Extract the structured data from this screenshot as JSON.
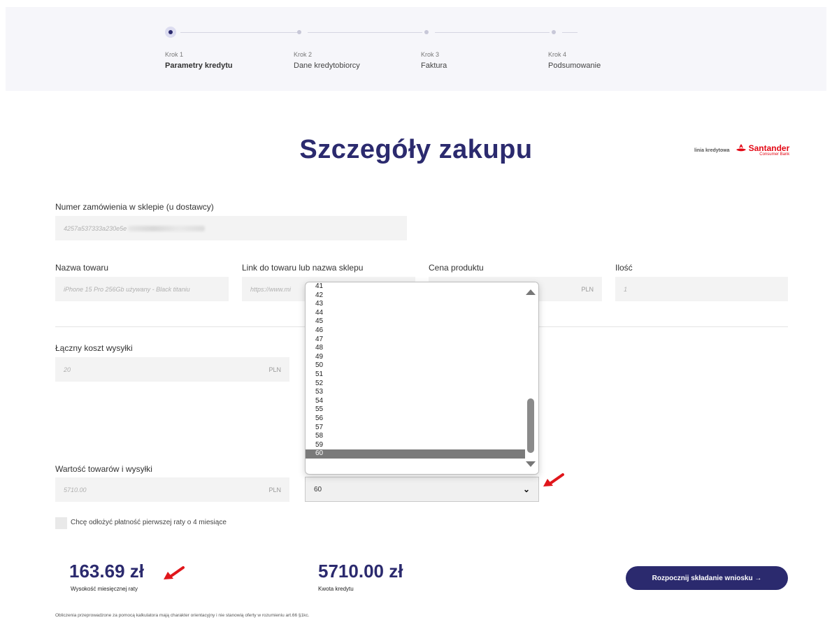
{
  "stepper": {
    "steps": [
      {
        "krok": "Krok 1",
        "name": "Parametry kredytu"
      },
      {
        "krok": "Krok 2",
        "name": "Dane kredytobiorcy"
      },
      {
        "krok": "Krok 3",
        "name": "Faktura"
      },
      {
        "krok": "Krok 4",
        "name": "Podsumowanie"
      }
    ]
  },
  "page": {
    "title": "Szczegóły zakupu"
  },
  "brand": {
    "linia": "linia kredytowa",
    "name": "Santander",
    "sub": "Consumer Bank",
    "color": "#e30613"
  },
  "form": {
    "order_label": "Numer zamówienia w sklepie (u dostawcy)",
    "order_value": "4257a537333a230e5e",
    "product_label": "Nazwa towaru",
    "product_value": "iPhone 15 Pro  256Gb używany - Black titaniu",
    "link_label": "Link do towaru lub nazwa sklepu",
    "link_value": "https://www.mi",
    "price_label": "Cena produktu",
    "price_unit": "PLN",
    "qty_label": "Ilość",
    "qty_value": "1",
    "shipping_label": "Łączny koszt wysyłki",
    "shipping_value": "20",
    "shipping_unit": "PLN",
    "total_label": "Wartość towarów i wysyłki",
    "total_value": "5710.00",
    "total_unit": "PLN",
    "installments_selected": "60",
    "installments_options": [
      "41",
      "42",
      "43",
      "44",
      "45",
      "46",
      "47",
      "48",
      "49",
      "50",
      "51",
      "52",
      "53",
      "54",
      "55",
      "56",
      "57",
      "58",
      "59",
      "60"
    ],
    "defer_label": "Chcę odłożyć płatność pierwszej raty o 4 miesiące"
  },
  "summary": {
    "monthly_amount": "163.69 zł",
    "monthly_label": "Wysokość miesięcznej raty",
    "credit_amount": "5710.00 zł",
    "credit_label": "Kwota kredytu",
    "cta_label": "Rozpocznij składanie wniosku →"
  },
  "footnote": "Obliczenia przeprowadzone za pomocą kalkulatora mają charakter orientacyjny i nie stanowią oferty w rozumieniu art.66 §1kc.",
  "colors": {
    "primary": "#2b2a6e",
    "annotation_arrow": "#e0161b"
  }
}
